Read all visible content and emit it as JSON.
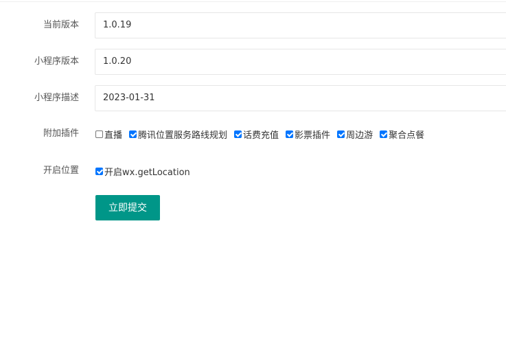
{
  "form": {
    "current_version": {
      "label": "当前版本",
      "value": "1.0.19"
    },
    "miniprogram_version": {
      "label": "小程序版本",
      "value": "1.0.20"
    },
    "miniprogram_description": {
      "label": "小程序描述",
      "value": "2023-01-31"
    },
    "addons": {
      "label": "附加插件",
      "options": [
        {
          "label": "直播",
          "checked": false
        },
        {
          "label": "腾讯位置服务路线规划",
          "checked": true
        },
        {
          "label": "话费充值",
          "checked": true
        },
        {
          "label": "影票插件",
          "checked": true
        },
        {
          "label": "周边游",
          "checked": true
        },
        {
          "label": "聚合点餐",
          "checked": true
        }
      ]
    },
    "location": {
      "label": "开启位置",
      "option": {
        "label": "开启wx.getLocation",
        "checked": true
      }
    },
    "submit_label": "立即提交"
  },
  "colors": {
    "accent": "#009688",
    "checkbox": "#0075ff"
  }
}
